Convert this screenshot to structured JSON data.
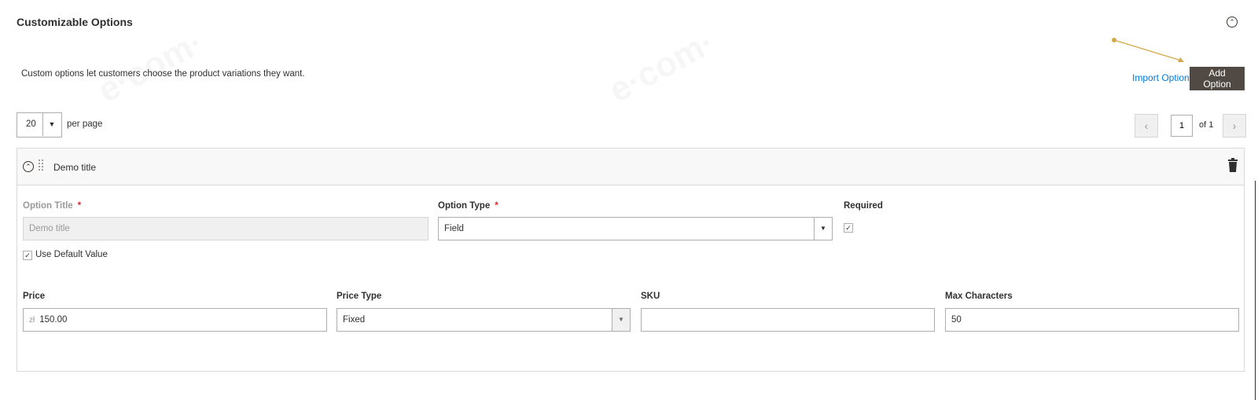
{
  "section": {
    "title": "Customizable Options",
    "description": "Custom options let customers choose the product variations they want.",
    "collapse_icon": "collapse-circle-icon"
  },
  "actions": {
    "import_label": "Import Options",
    "add_label": "Add Option"
  },
  "toolbar": {
    "per_page_value": "20",
    "per_page_label": "per page",
    "current_page": "1",
    "total_pages_label": "of 1"
  },
  "option": {
    "header_title": "Demo title",
    "option_title_label": "Option Title",
    "option_title_value": "Demo title",
    "option_type_label": "Option Type",
    "option_type_value": "Field",
    "required_label": "Required",
    "required_checked": true,
    "use_default_label": "Use Default Value",
    "use_default_checked": true,
    "price_label": "Price",
    "price_currency": "zł",
    "price_value": "150.00",
    "price_type_label": "Price Type",
    "price_type_value": "Fixed",
    "sku_label": "SKU",
    "sku_value": "",
    "max_chars_label": "Max Characters",
    "max_chars_value": "50",
    "required_marker": "*"
  },
  "colors": {
    "accent_button": "#514943",
    "link": "#007bdb",
    "required": "#e22626",
    "annotation_arrow": "#d4a84a"
  }
}
